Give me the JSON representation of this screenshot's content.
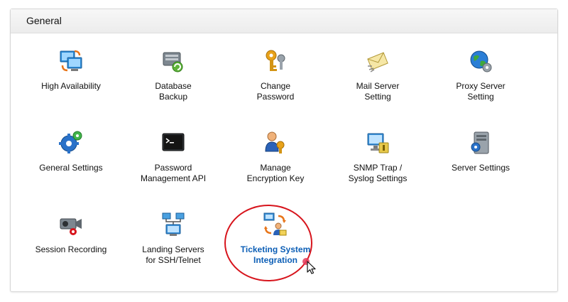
{
  "section": {
    "title": "General"
  },
  "items": [
    {
      "label": "High Availability",
      "icon": "high-availability-icon"
    },
    {
      "label": "Database\nBackup",
      "icon": "database-backup-icon"
    },
    {
      "label": "Change\nPassword",
      "icon": "key-icon"
    },
    {
      "label": "Mail Server\nSetting",
      "icon": "mail-server-icon"
    },
    {
      "label": "Proxy Server\nSetting",
      "icon": "proxy-server-icon"
    },
    {
      "label": "General Settings",
      "icon": "gear-icon"
    },
    {
      "label": "Password\nManagement API",
      "icon": "terminal-icon"
    },
    {
      "label": "Manage\nEncryption Key",
      "icon": "encryption-key-icon"
    },
    {
      "label": "SNMP Trap /\nSyslog Settings",
      "icon": "snmp-trap-icon"
    },
    {
      "label": "Server Settings",
      "icon": "server-icon"
    },
    {
      "label": "Session Recording",
      "icon": "camera-icon"
    },
    {
      "label": "Landing Servers\nfor SSH/Telnet",
      "icon": "network-icon"
    },
    {
      "label": "Ticketing System\nIntegration",
      "icon": "ticketing-icon"
    }
  ],
  "colors": {
    "highlight_text": "#0d5fb6",
    "highlight_ring": "#d7141c"
  }
}
